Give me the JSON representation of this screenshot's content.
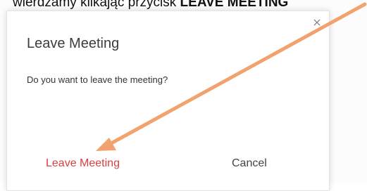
{
  "instruction": {
    "prefix": "wierdzamy klikając przycisk ",
    "bold": "LEAVE MEETING"
  },
  "dialog": {
    "title": "Leave Meeting",
    "message": "Do you want to leave the meeting?",
    "close_icon": "close-icon",
    "leave_label": "Leave Meeting",
    "cancel_label": "Cancel"
  },
  "colors": {
    "leave_text": "#d94040",
    "annotation_arrow": "#f2a26e"
  },
  "annotation": {
    "icon": "arrow-icon"
  }
}
